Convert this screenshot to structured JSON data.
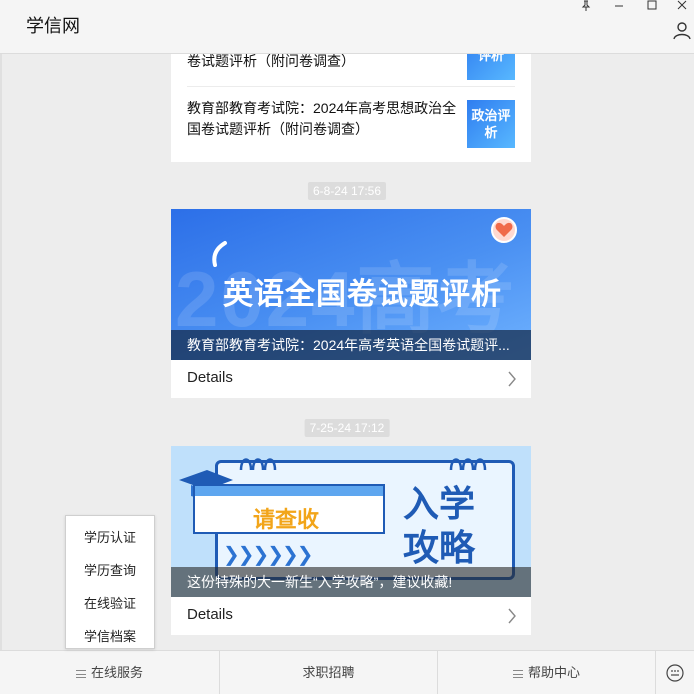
{
  "window": {
    "title": "学信网",
    "pin_icon": "pin-icon",
    "minimize_icon": "minimize-icon",
    "maximize_icon": "maximize-icon",
    "close_icon": "close-icon",
    "profile_icon": "user-icon"
  },
  "feed": {
    "news_items": [
      {
        "title": "卷试题评析（附问卷调查）",
        "thumb": "评析"
      },
      {
        "title": "教育部教育考试院：2024年高考思想政治全国卷试题评析（附问卷调查）",
        "thumb": "政治评析"
      }
    ],
    "posts": [
      {
        "timestamp": "6-8-24 17:56",
        "banner_headline": "英语全国卷试题评析",
        "banner_watermark": "2024高考",
        "caption": "教育部教育考试院：2024年高考英语全国卷试题评...",
        "details": "Details"
      },
      {
        "timestamp": "7-25-24 17:12",
        "banner_left": "请查收",
        "banner_right_1": "入学",
        "banner_right_2": "攻略",
        "caption": "这份特殊的大一新生“入学攻略”，建议收藏!",
        "details": "Details"
      }
    ]
  },
  "popup": {
    "items": [
      "学历认证",
      "学历查询",
      "在线验证",
      "学信档案"
    ]
  },
  "bottom_bar": {
    "items": [
      "在线服务",
      "求职招聘",
      "帮助中心"
    ],
    "keyboard_icon": "keyboard-icon"
  },
  "colors": {
    "accent_blue": "#2f7df0",
    "banner_dark": "#1b3a63"
  }
}
